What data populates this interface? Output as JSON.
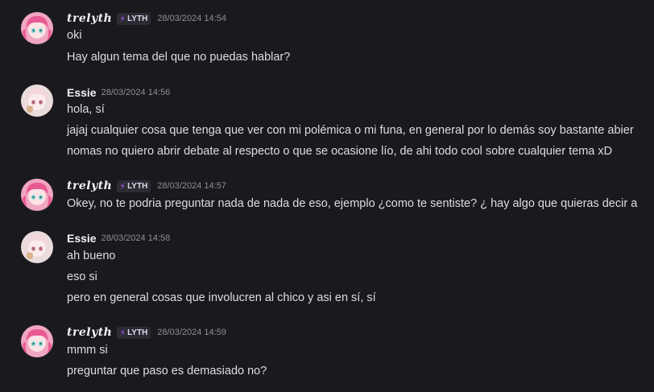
{
  "messages": [
    {
      "author": "trelyth",
      "tag": "LYTH",
      "timestamp": "28/03/2024 14:54",
      "lines": [
        "oki",
        "Hay algun tema del que no puedas hablar?"
      ]
    },
    {
      "author": "Essie",
      "tag": "",
      "timestamp": "28/03/2024 14:56",
      "lines": [
        "hola, sí",
        "jajaj cualquier cosa que tenga que ver con mi polémica o mi funa, en general por lo demás soy bastante abier",
        "nomas no quiero abrir debate al respecto o que se ocasione lío, de ahi todo cool sobre cualquier tema xD"
      ]
    },
    {
      "author": "trelyth",
      "tag": "LYTH",
      "timestamp": "28/03/2024 14:57",
      "lines": [
        "Okey, no te podria preguntar nada de nada de eso, ejemplo ¿como te sentiste? ¿ hay algo que quieras decir a"
      ]
    },
    {
      "author": "Essie",
      "tag": "",
      "timestamp": "28/03/2024 14:58",
      "lines": [
        "ah bueno",
        "eso si",
        "pero en general cosas que involucren al chico y asi en sí, sí"
      ]
    },
    {
      "author": "trelyth",
      "tag": "LYTH",
      "timestamp": "28/03/2024 14:59",
      "lines": [
        "mmm si",
        "preguntar que paso es demasiado no?"
      ]
    }
  ],
  "colors": {
    "background": "#1a1a1e",
    "text": "#dbdee1",
    "username": "#f2f3f5",
    "timestamp": "#8c8f96",
    "tag_icon": "#b061ff"
  },
  "icons": {
    "tag": "lightning-bolt-icon"
  }
}
